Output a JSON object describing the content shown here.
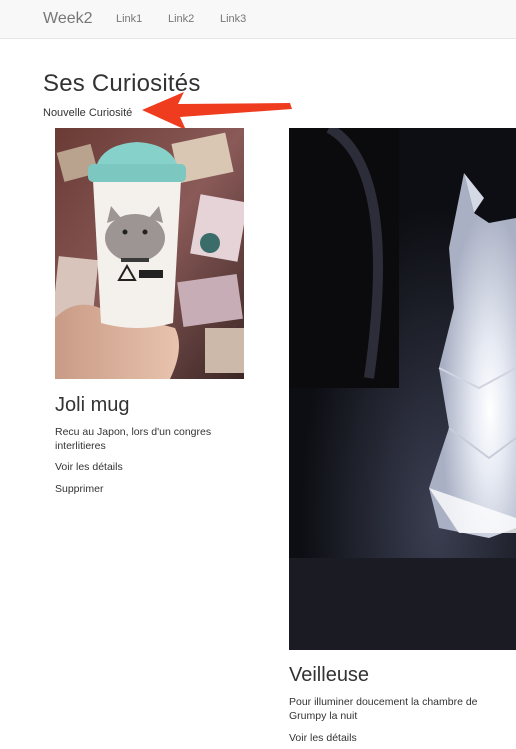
{
  "navbar": {
    "brand": "Week2",
    "links": [
      "Link1",
      "Link2",
      "Link3"
    ]
  },
  "main": {
    "title": "Ses Curiosités",
    "new_link": "Nouvelle Curiosité"
  },
  "cards": [
    {
      "title": "Joli mug",
      "description": "Recu au Japon, lors d'un congres interlitieres",
      "details_label": "Voir les détails",
      "delete_label": "Supprimer"
    },
    {
      "title": "Veilleuse",
      "description": "Pour illuminer doucement la chambre de Grumpy la nuit",
      "details_label": "Voir les détails"
    }
  ],
  "annotation": {
    "arrow_color": "#f03c1e"
  }
}
